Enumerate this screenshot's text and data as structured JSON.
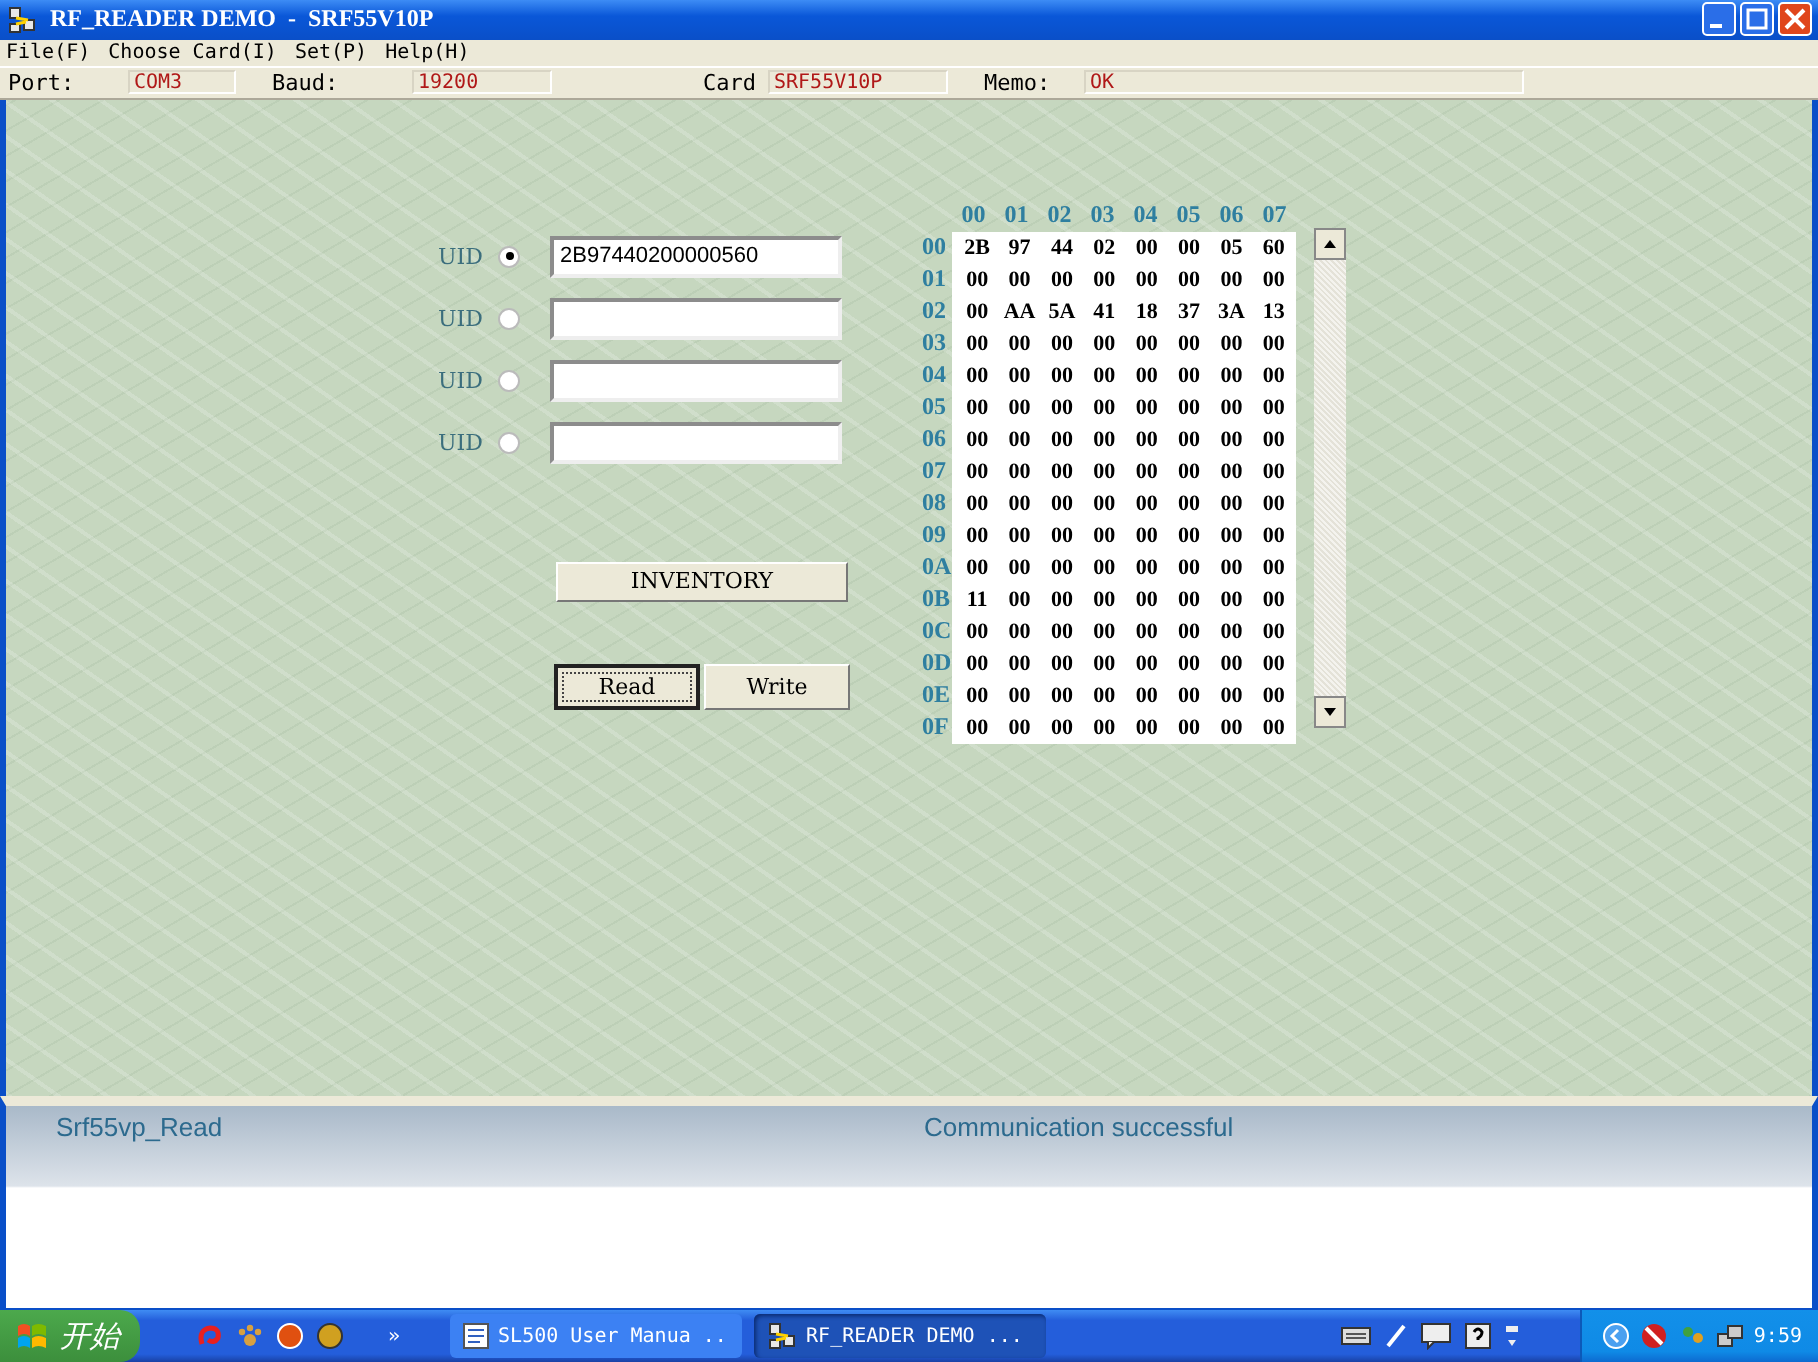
{
  "window": {
    "title": "RF_READER DEMO",
    "separator": "-",
    "subtitle": "SRF55V10P"
  },
  "menu": [
    "File(F)",
    "Choose Card(I)",
    "Set(P)",
    "Help(H)"
  ],
  "info_bar": [
    {
      "label": "Port:",
      "value": "COM3"
    },
    {
      "label": "Baud:",
      "value": "19200"
    },
    {
      "label": "Card",
      "value": "SRF55V10P"
    },
    {
      "label": "Memo:",
      "value": "OK"
    }
  ],
  "uid_rows": [
    {
      "label": "UID",
      "selected": true,
      "value": "2B97440200000560"
    },
    {
      "label": "UID",
      "selected": false
    },
    {
      "label": "UID",
      "selected": false
    },
    {
      "label": "UID",
      "selected": false
    }
  ],
  "inventory_button": "INVENTORY",
  "buttons": [
    {
      "label": "Read",
      "focused": true
    },
    {
      "label": "Write",
      "focused": false
    }
  ],
  "hex": {
    "columns": [
      "00",
      "01",
      "02",
      "03",
      "04",
      "05",
      "06",
      "07"
    ],
    "rows": [
      {
        "address": "00",
        "cells": [
          "2B",
          "97",
          "44",
          "02",
          "00",
          "00",
          "05",
          "60"
        ]
      },
      {
        "address": "01",
        "cells": [
          "00",
          "00",
          "00",
          "00",
          "00",
          "00",
          "00",
          "00"
        ]
      },
      {
        "address": "02",
        "cells": [
          "00",
          "AA",
          "5A",
          "41",
          "18",
          "37",
          "3A",
          "13"
        ]
      },
      {
        "address": "03",
        "cells": [
          "00",
          "00",
          "00",
          "00",
          "00",
          "00",
          "00",
          "00"
        ]
      },
      {
        "address": "04",
        "cells": [
          "00",
          "00",
          "00",
          "00",
          "00",
          "00",
          "00",
          "00"
        ]
      },
      {
        "address": "05",
        "cells": [
          "00",
          "00",
          "00",
          "00",
          "00",
          "00",
          "00",
          "00"
        ]
      },
      {
        "address": "06",
        "cells": [
          "00",
          "00",
          "00",
          "00",
          "00",
          "00",
          "00",
          "00"
        ]
      },
      {
        "address": "07",
        "cells": [
          "00",
          "00",
          "00",
          "00",
          "00",
          "00",
          "00",
          "00"
        ]
      },
      {
        "address": "08",
        "cells": [
          "00",
          "00",
          "00",
          "00",
          "00",
          "00",
          "00",
          "00"
        ]
      },
      {
        "address": "09",
        "cells": [
          "00",
          "00",
          "00",
          "00",
          "00",
          "00",
          "00",
          "00"
        ]
      },
      {
        "address": "0A",
        "cells": [
          "00",
          "00",
          "00",
          "00",
          "00",
          "00",
          "00",
          "00"
        ]
      },
      {
        "address": "0B",
        "cells": [
          "11",
          "00",
          "00",
          "00",
          "00",
          "00",
          "00",
          "00"
        ]
      },
      {
        "address": "0C",
        "cells": [
          "00",
          "00",
          "00",
          "00",
          "00",
          "00",
          "00",
          "00"
        ]
      },
      {
        "address": "0D",
        "cells": [
          "00",
          "00",
          "00",
          "00",
          "00",
          "00",
          "00",
          "00"
        ]
      },
      {
        "address": "0E",
        "cells": [
          "00",
          "00",
          "00",
          "00",
          "00",
          "00",
          "00",
          "00"
        ]
      },
      {
        "address": "0F",
        "cells": [
          "00",
          "00",
          "00",
          "00",
          "00",
          "00",
          "00",
          "00"
        ]
      }
    ]
  },
  "status": {
    "function": "Srf55vp_Read",
    "message": "Communication successful"
  },
  "taskbar": {
    "start": "开始",
    "chevron": "»",
    "tasks": [
      {
        "label": "SL500 User Manua ..",
        "selected": false
      },
      {
        "label": "RF_READER DEMO ...",
        "selected": true
      }
    ],
    "clock": "9:59"
  }
}
